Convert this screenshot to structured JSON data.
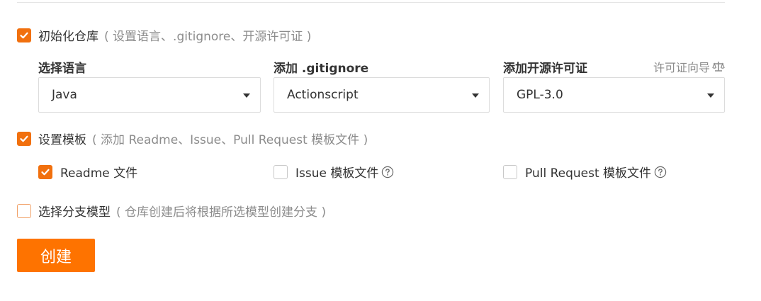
{
  "init_repo": {
    "checked": true,
    "label": "初始化仓库",
    "hint": "( 设置语言、.gitignore、开源许可证 )"
  },
  "language": {
    "label": "选择语言",
    "value": "Java"
  },
  "gitignore": {
    "label": "添加 .gitignore",
    "value": "Actionscript"
  },
  "license": {
    "label": "添加开源许可证",
    "value": "GPL-3.0",
    "guide_label": "许可证向导"
  },
  "template": {
    "checked": true,
    "label": "设置模板",
    "hint": "( 添加 Readme、Issue、Pull Request 模板文件 )",
    "options": [
      {
        "label": "Readme 文件",
        "checked": true
      },
      {
        "label": "Issue 模板文件",
        "checked": false
      },
      {
        "label": "Pull Request 模板文件",
        "checked": false
      }
    ]
  },
  "branch_model": {
    "checked": false,
    "label": "选择分支模型",
    "hint": "( 仓库创建后将根据所选模型创建分支 )"
  },
  "create_button": {
    "label": "创建"
  },
  "colors": {
    "accent": "#f1700e",
    "button": "#fe7300"
  }
}
